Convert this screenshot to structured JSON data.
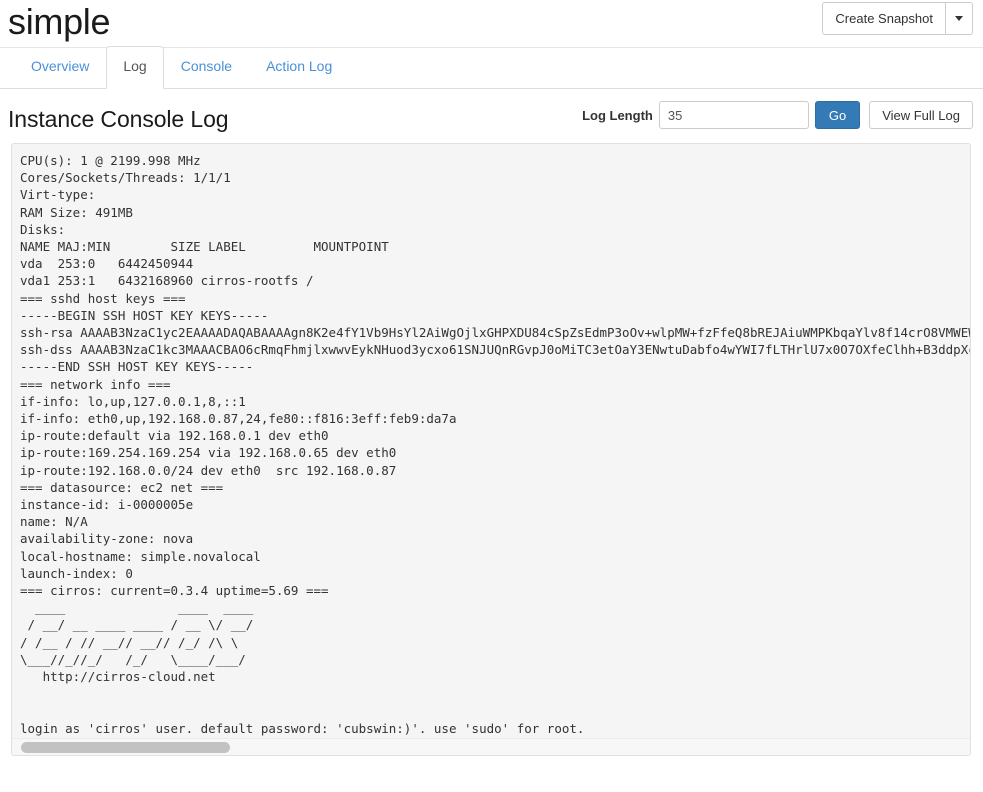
{
  "header": {
    "title": "simple",
    "snapshot_button": "Create Snapshot",
    "caret_icon": "chevron-down-icon"
  },
  "tabs": [
    {
      "label": "Overview",
      "active": false
    },
    {
      "label": "Log",
      "active": true
    },
    {
      "label": "Console",
      "active": false
    },
    {
      "label": "Action Log",
      "active": false
    }
  ],
  "log_controls": {
    "length_label": "Log Length",
    "length_value": "35",
    "length_placeholder": "",
    "go_button": "Go",
    "view_full_button": "View Full Log",
    "go_button_color": "#337ab7"
  },
  "section": {
    "title": "Instance Console Log"
  },
  "console_log": {
    "text": "CPU(s): 1 @ 2199.998 MHz\nCores/Sockets/Threads: 1/1/1\nVirt-type:\nRAM Size: 491MB\nDisks:\nNAME MAJ:MIN        SIZE LABEL         MOUNTPOINT\nvda  253:0   6442450944\nvda1 253:1   6432168960 cirros-rootfs /\n=== sshd host keys ===\n-----BEGIN SSH HOST KEY KEYS-----\nssh-rsa AAAAB3NzaC1yc2EAAAADAQABAAAAgn8K2e4fY1Vb9HsYl2AiWgOjlxGHPXDU84cSpZsEdmP3oOv+wlpMW+fzFfeQ8bREJAiuWMPKbqaYlv8f14crO8VMWEWkUTbC3\nssh-dss AAAAB3NzaC1kc3MAAACBAO6cRmqFhmjlxwwvEykNHuod3ycxo61SNJUQnRGvpJ0oMiTC3etOaY3ENwtuDabfo4wYWI7fLTHrlU7x0O7OXfeClhh+B3ddpXc/UJ+0\n-----END SSH HOST KEY KEYS-----\n=== network info ===\nif-info: lo,up,127.0.0.1,8,::1\nif-info: eth0,up,192.168.0.87,24,fe80::f816:3eff:feb9:da7a\nip-route:default via 192.168.0.1 dev eth0\nip-route:169.254.169.254 via 192.168.0.65 dev eth0\nip-route:192.168.0.0/24 dev eth0  src 192.168.0.87\n=== datasource: ec2 net ===\ninstance-id: i-0000005e\nname: N/A\navailability-zone: nova\nlocal-hostname: simple.novalocal\nlaunch-index: 0\n=== cirros: current=0.3.4 uptime=5.69 ===\n  ____               ____  ____\n / __/ __ ____ ____ / __ \\/ __/\n/ /__ / // __// __// /_/ /\\ \\ \n\\___//_//_/   /_/   \\____/___/ \n   http://cirros-cloud.net\n\n\nlogin as 'cirros' user. default password: 'cubswin:)'. use 'sudo' for root.\nsimple login:",
    "scrollbar": {
      "orientation": "horizontal",
      "thumb_fraction": 0.22
    }
  }
}
